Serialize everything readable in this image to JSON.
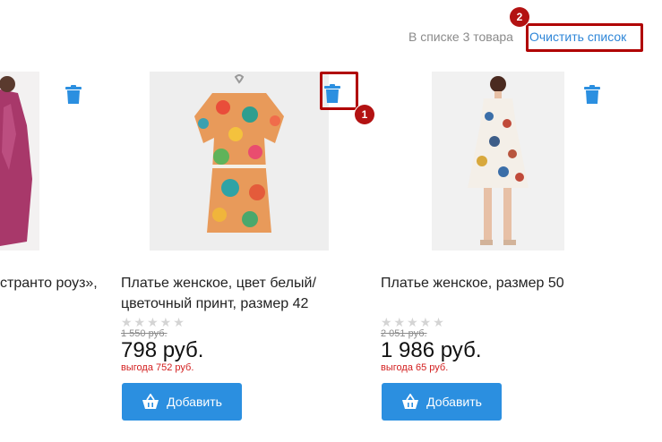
{
  "header": {
    "count_text": "В списке 3 товара",
    "clear_label": "Очистить список"
  },
  "callouts": [
    {
      "number": "1"
    },
    {
      "number": "2"
    }
  ],
  "products": [
    {
      "title": "странто роуз»,",
      "old_price": "",
      "price": "",
      "benefit": "",
      "button_label": "",
      "image_desc": "woman in patterned pink dress"
    },
    {
      "title": "Платье женское, цвет белый/ цветочный принт, размер 42",
      "old_price": "1 550 руб.",
      "price": "798 руб.",
      "benefit": "выгода 752 руб.",
      "button_label": "Добавить",
      "stars": "★★★★★",
      "image_desc": "floral dress on hanger"
    },
    {
      "title": "Платье женское, размер 50",
      "old_price": "2 051 руб.",
      "price": "1 986 руб.",
      "benefit": "выгода 65 руб.",
      "button_label": "Добавить",
      "stars": "★★★★★",
      "image_desc": "woman in white dress with print"
    }
  ],
  "colors": {
    "accent": "#2b8fe0",
    "link": "#2e86d8",
    "benefit": "#d32020",
    "callout": "#b00000"
  },
  "icons": [
    "trash-icon",
    "basket-icon"
  ]
}
